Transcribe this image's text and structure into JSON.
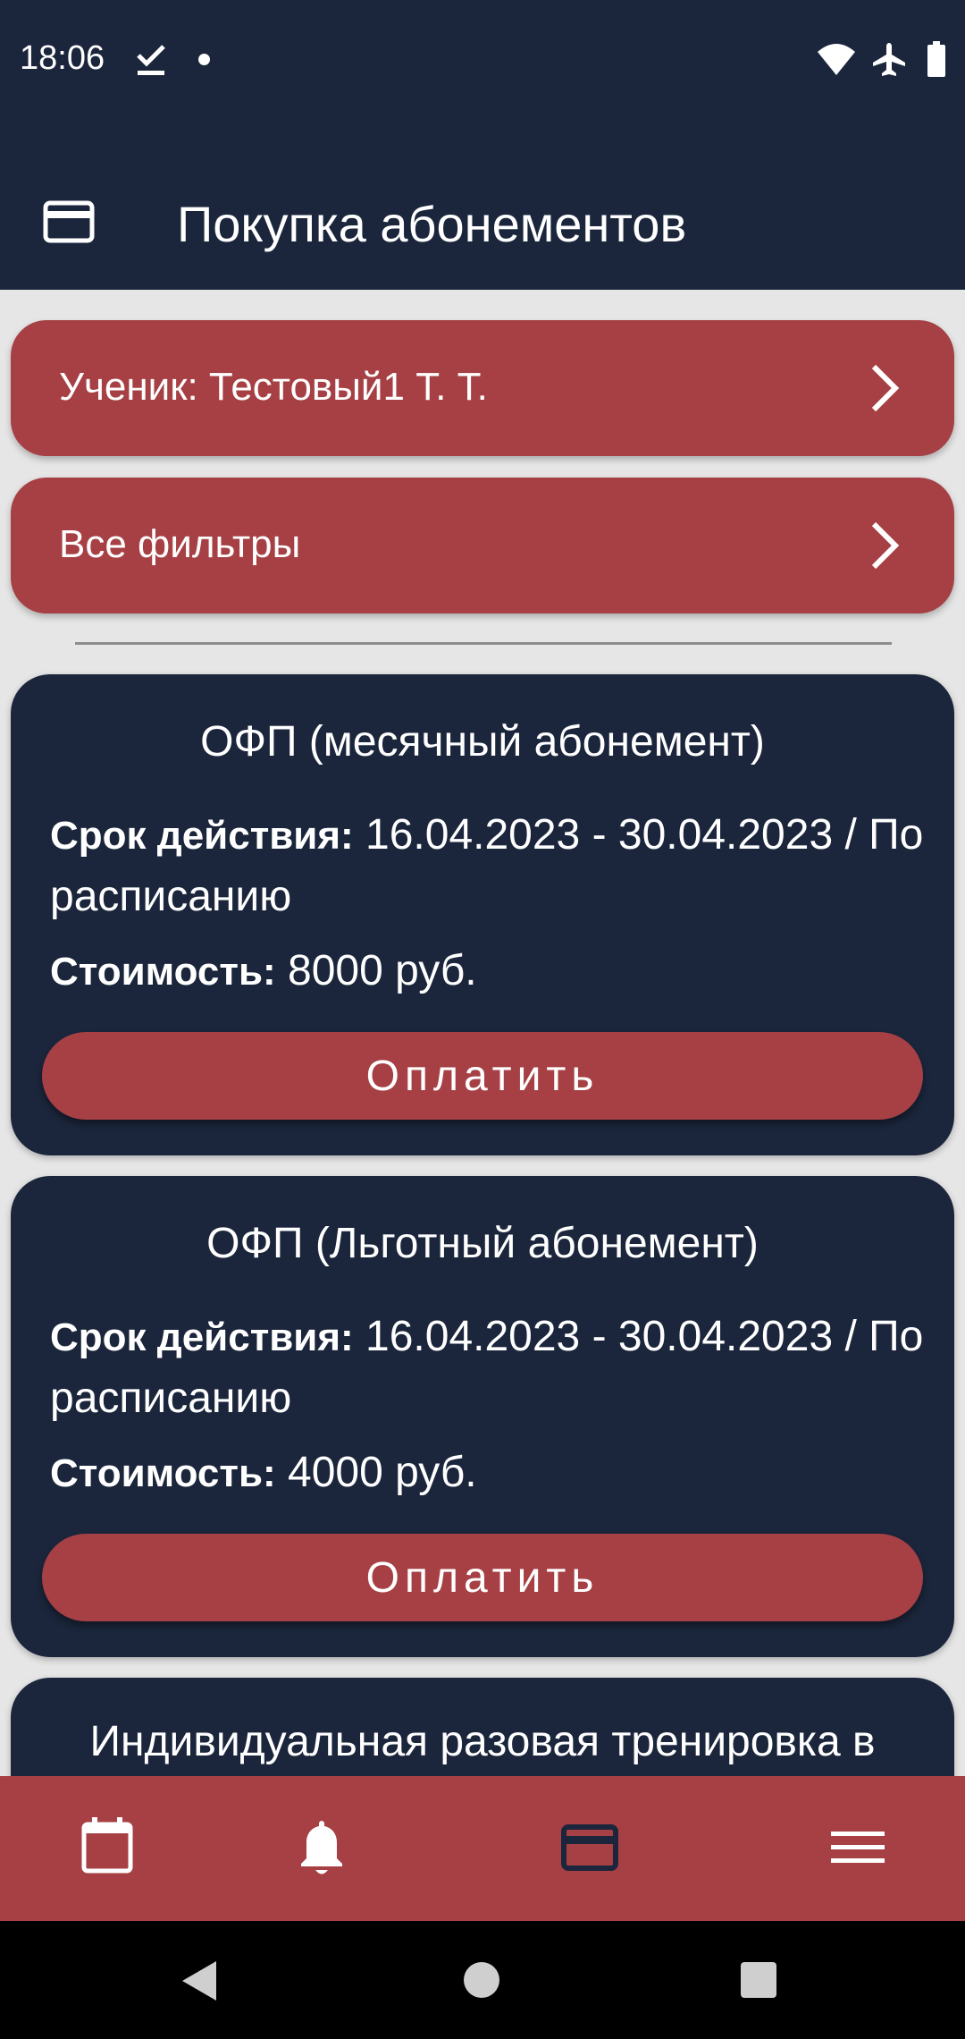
{
  "status_bar": {
    "time": "18:06",
    "icons": [
      "download-done-icon",
      "notification-dot-icon",
      "wifi-icon",
      "airplane-icon",
      "battery-icon"
    ]
  },
  "app_bar": {
    "icon": "credit-card-icon",
    "title": "Покупка абонементов"
  },
  "filters": {
    "student_label": "Ученик: Тестовый1 Т. Т.",
    "all_filters_label": "Все фильтры"
  },
  "cards": [
    {
      "title": "ОФП (месячный абонемент)",
      "period_label": "Срок действия:",
      "period_value": "16.04.2023 - 30.04.2023 / По расписанию",
      "price_label": "Стоимость:",
      "price_value": "8000 руб.",
      "button_label": "Оплатить"
    },
    {
      "title": "ОФП (Льготный абонемент)",
      "period_label": "Срок действия:",
      "period_value": "16.04.2023 - 30.04.2023 / По расписанию",
      "price_label": "Стоимость:",
      "price_value": "4000 руб.",
      "button_label": "Оплатить"
    },
    {
      "title": "Индивидуальная разовая тренировка в"
    }
  ],
  "bottom_nav": {
    "items": [
      "calendar-icon",
      "bell-icon",
      "credit-card-icon",
      "menu-icon"
    ],
    "active": "credit-card-icon"
  },
  "colors": {
    "primary_dark": "#1b263c",
    "accent_red": "#a64044",
    "background": "#e6e6e6"
  }
}
